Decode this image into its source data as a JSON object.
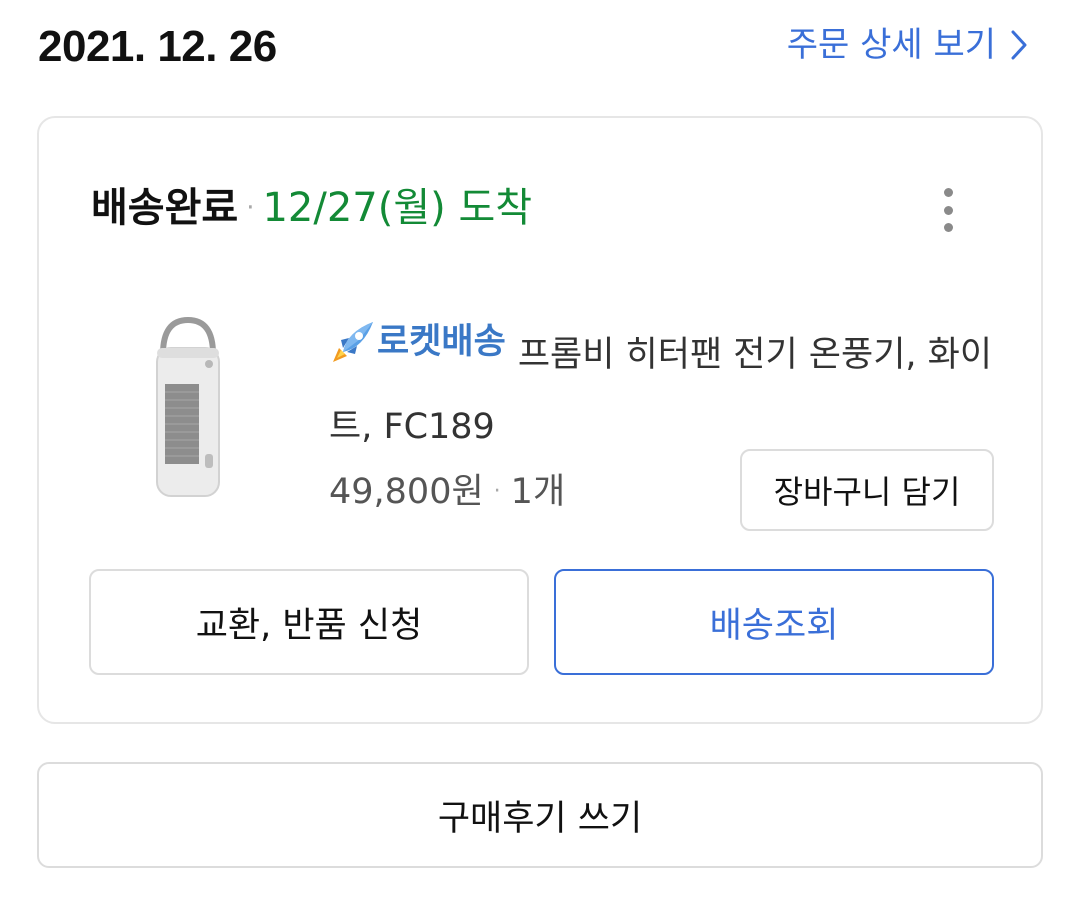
{
  "order": {
    "date": "2021. 12. 26",
    "detail_link_label": "주문 상세 보기"
  },
  "shipment": {
    "status": "배송완료",
    "separator": "·",
    "arrival": "12/27(월) 도착"
  },
  "product": {
    "badge_label": "로켓배송",
    "name": "프롬비 히터팬 전기 온풍기, 화이트, FC189",
    "price": "49,800원",
    "separator": "·",
    "quantity": "1개",
    "add_to_cart_label": "장바구니 담기"
  },
  "actions": {
    "return_label": "교환, 반품 신청",
    "track_label": "배송조회"
  },
  "review": {
    "write_label": "구매후기 쓰기"
  },
  "colors": {
    "accent_blue": "#3a6fd8",
    "arrival_green": "#138a36",
    "rocket_blue": "#3a78c6"
  },
  "icons": {
    "detail_link": "chevron-right-icon",
    "more": "more-vertical-icon",
    "badge": "rocket-icon"
  }
}
